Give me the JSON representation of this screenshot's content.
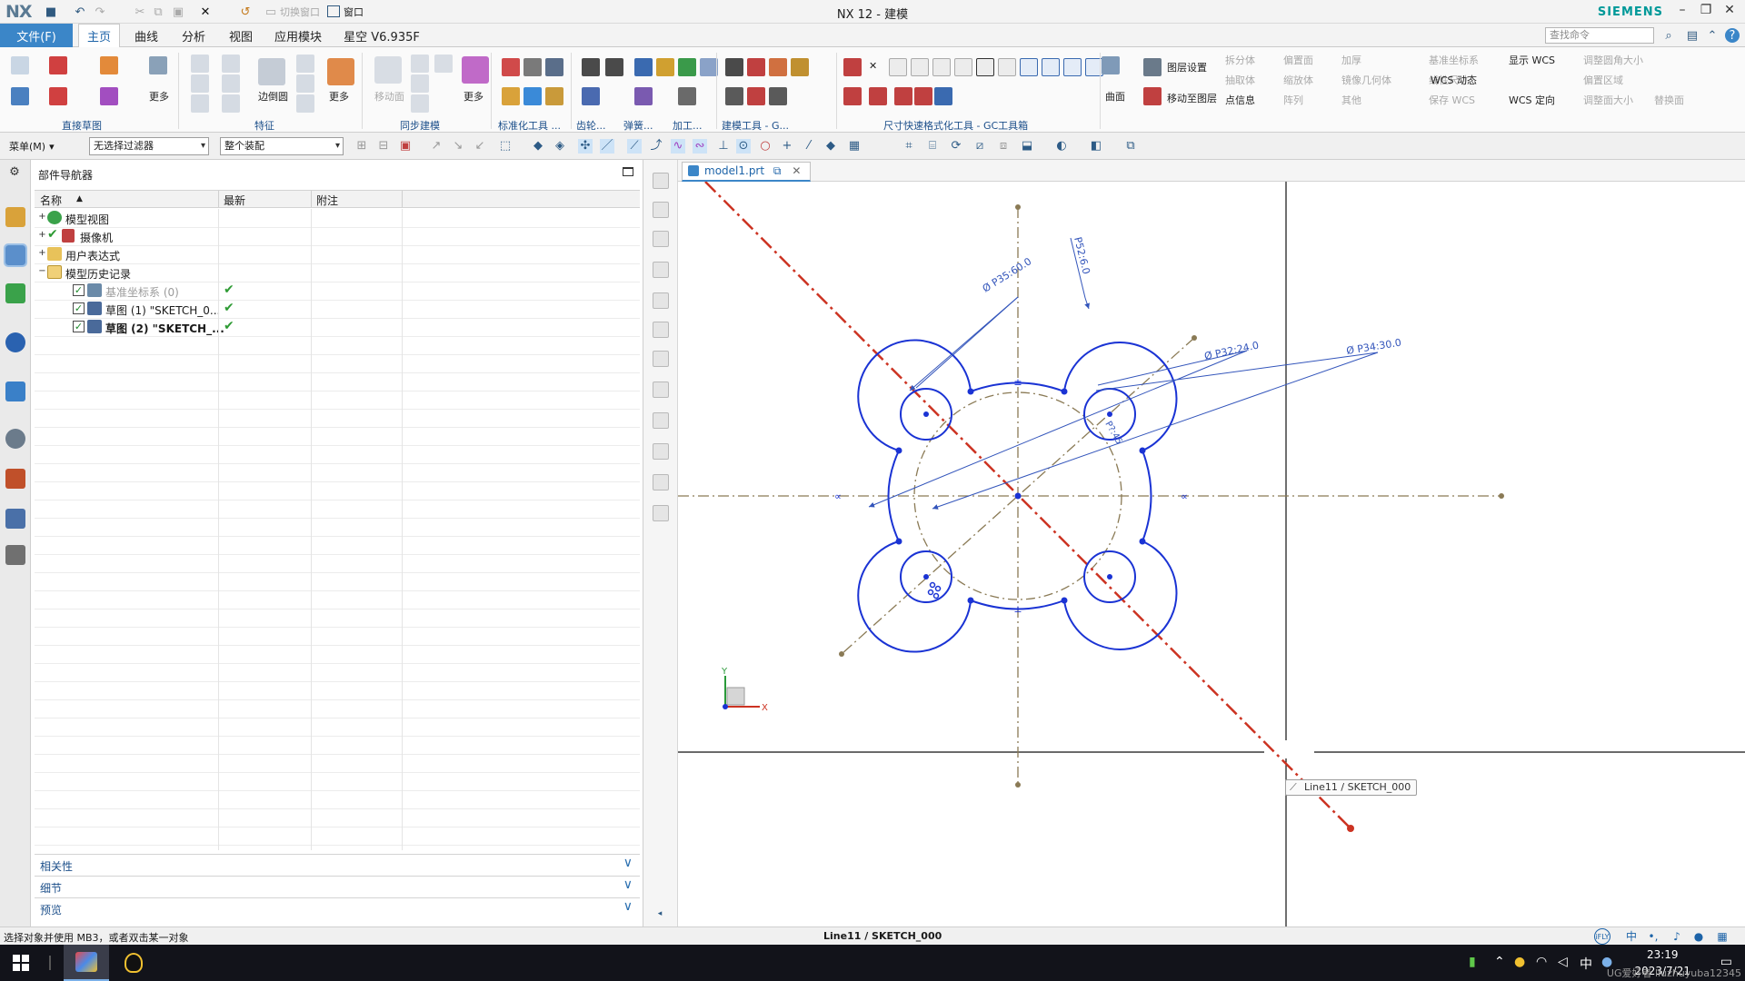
{
  "app": {
    "logo": "NX",
    "window_title": "NX 12 - 建模",
    "brand": "SIEMENS"
  },
  "ribbon": {
    "file_tab": "文件(F)",
    "tabs": [
      "主页",
      "曲线",
      "分析",
      "视图",
      "应用模块",
      "星空 V6.935F"
    ],
    "active_tab": "主页",
    "command_search_placeholder": "查找命令",
    "window_menu": "窗口",
    "switch_window": "切换窗口",
    "groups": [
      "直接草图",
      "特征",
      "同步建模",
      "标准化工具 ...",
      "齿轮...",
      "弹簧...",
      "加工...",
      "建模工具 - G...",
      "尺寸快速格式化工具 - GC工具箱"
    ],
    "buttons": {
      "more1": "更多",
      "edge_blend": "边倒圆",
      "more2": "更多",
      "move_face": "移动面",
      "more3": "更多",
      "layer_settings": "图层设置",
      "move_to_layer": "移动至图层",
      "surface": "曲面",
      "show_wcs": "显示 WCS",
      "wcs_dynamic": "WCS 动态",
      "wcs_orient": "WCS 定向",
      "point_info": "点信息",
      "split_body": "拆分体",
      "offset_face": "偏置面",
      "thicken": "加厚",
      "extract_body": "抽取体",
      "shell": "缩放体",
      "mirror_geom": "镜像几何体",
      "datum_csys": "基准坐标系",
      "linear_dim": "线性尺寸",
      "save_wcs": "保存 WCS",
      "adjust_blend": "调整圆角大小",
      "offset_region": "偏置区域",
      "adjust_size": "调整面大小",
      "replace_face": "替换面",
      "pattern": "阵列",
      "other": "其他"
    }
  },
  "selection_bar": {
    "menu": "菜单(M)",
    "filter": "无选择过滤器",
    "scope": "整个装配"
  },
  "navigator": {
    "title": "部件导航器",
    "columns": [
      "名称",
      "最新",
      "附注"
    ],
    "nodes": [
      {
        "label": "模型视图",
        "level": 0,
        "expander": "+",
        "latest": ""
      },
      {
        "label": "摄像机",
        "level": 0,
        "expander": "+",
        "latest": ""
      },
      {
        "label": "用户表达式",
        "level": 0,
        "expander": "+",
        "latest": ""
      },
      {
        "label": "模型历史记录",
        "level": 0,
        "expander": "−",
        "latest": ""
      },
      {
        "label": "基准坐标系 (0)",
        "level": 1,
        "expander": "",
        "latest": "✔"
      },
      {
        "label": "草图 (1) \"SKETCH_0...",
        "level": 1,
        "expander": "",
        "latest": "✔"
      },
      {
        "label": "草图 (2) \"SKETCH_...",
        "level": 1,
        "expander": "",
        "latest": "✔"
      }
    ],
    "panels": [
      "相关性",
      "细节",
      "预览"
    ]
  },
  "graphics": {
    "doc_tab": "model1.prt",
    "tooltip": "Line11 / SKETCH_000",
    "axis_x": "X",
    "axis_y": "Y",
    "dimensions": {
      "d1": "Ø P35:60.0",
      "d2": "P52:6.0",
      "d3": "P?:45",
      "d4": "Ø P32:24.0",
      "d5": "Ø P34:30.0"
    }
  },
  "status": {
    "prompt": "选择对象并使用 MB3，或者双击某一对象",
    "selection": "Line11 / SKETCH_000"
  },
  "taskbar": {
    "time": "23:19",
    "date": "2023/7/21",
    "ime": "中",
    "watermark": "UG爱好者 liuzhuyuba12345"
  },
  "colors": {
    "accent": "#3b86c8",
    "sketch_curve": "#1a33d4",
    "centerline": "#8a7a55",
    "selected_line": "#cc3322",
    "dimension": "#3355bb",
    "status_ok": "#2e9b34"
  }
}
